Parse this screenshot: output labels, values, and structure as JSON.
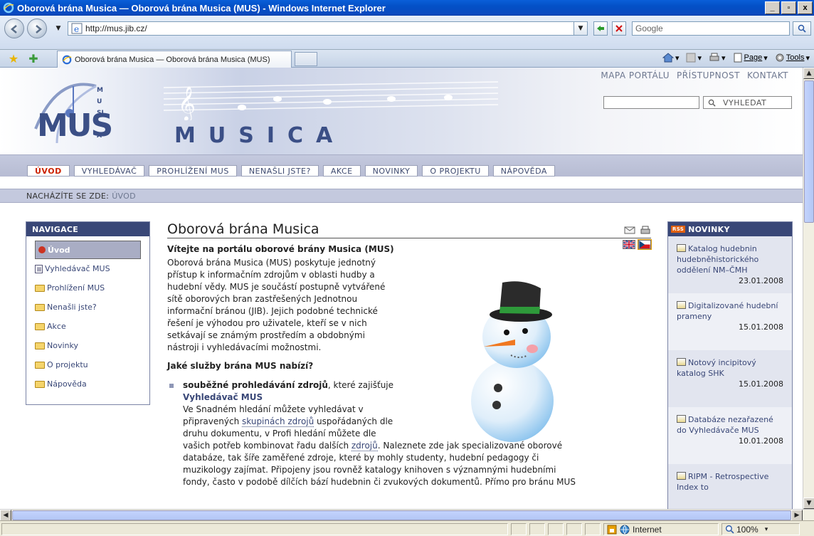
{
  "window": {
    "title": "Oborová brána Musica — Oborová brána Musica (MUS) - Windows Internet Explorer",
    "min": "_",
    "max": "▫",
    "close": "x"
  },
  "address": {
    "url": "http://mus.jib.cz/",
    "search_placeholder": "Google"
  },
  "tab": {
    "label": "Oborová brána Musica — Oborová brána Musica (MUS)"
  },
  "commands": {
    "page": "Page",
    "tools": "Tools"
  },
  "site": {
    "top_links": [
      "MAPA PORTÁLU",
      "PŘÍSTUPNOST",
      "KONTAKT"
    ],
    "search_button": "VYHLEDAT",
    "logo_text": "MUS",
    "logo_side": "MUSICA",
    "brand_word": "MUSICA",
    "nav": [
      "ÚVOD",
      "VYHLEDÁVAČ",
      "PROHLÍŽENÍ MUS",
      "NENAŠLI JSTE?",
      "AKCE",
      "NOVINKY",
      "O PROJEKTU",
      "NÁPOVĚDA"
    ],
    "breadcrumb_label": "NACHÁZÍTE SE ZDE:",
    "breadcrumb_here": "ÚVOD"
  },
  "leftnav": {
    "title": "NAVIGACE",
    "items": [
      "Úvod",
      "Vyhledávač MUS",
      "Prohlížení MUS",
      "Nenašli jste?",
      "Akce",
      "Novinky",
      "O projektu",
      "Nápověda"
    ]
  },
  "content": {
    "title": "Oborová brána Musica",
    "subtitle": "Vítejte na portálu oborové brány Musica (MUS)",
    "intro_lines": [
      "Oborová brána Musica (MUS) poskytuje jednotný",
      "přístup k informačním zdrojům v oblasti hudby a",
      "hudební vědy. MUS je součástí postupně vytvářené",
      "sítě oborových bran zastřešených Jednotnou",
      "informační bránou (JIB). Jejich podobné technické",
      "řešení je výhodou pro uživatele, kteří se v nich",
      "setkávají se známým prostředím a obdobnými",
      "nástroji i vyhledávacími možnostmi."
    ],
    "services_heading": "Jaké služby brána MUS nabízí?",
    "bullet_bold": "souběžné prohledávání zdrojů",
    "bullet_rest": ", které zajišťuje",
    "bullet_link": "Vyhledávač MUS",
    "b_line1": "Ve Snadném hledání můžete vyhledávat v",
    "b_line2_a": "připravených ",
    "b_line2_link": "skupinách zdrojů",
    "b_line2_b": " uspořádaných dle",
    "b_line3": "druhu dokumentu, v Profi hledání můžete dle",
    "b_line4_a": "vašich potřeb kombinovat řadu dalších ",
    "b_line4_link": "zdrojů",
    "b_line4_b": ". Naleznete zde jak specializované oborové",
    "b_line5": "databáze, tak šíře zaměřené zdroje, které by mohly studenty, hudební pedagogy či",
    "b_line6": "muzikology zajímat. Připojeny jsou rovněž katalogy knihoven s významnými hudebními",
    "b_line7": "fondy, často v podobě dílčích bází hudebnin či zvukových dokumentů. Přímo pro bránu MUS"
  },
  "news": {
    "title": "NOVINKY",
    "rss": "RSS",
    "items": [
      {
        "text": "Katalog hudebnin hudebněhistorického oddělení NM–ČMH",
        "date": "23.01.2008"
      },
      {
        "text": "Digitalizované hudební prameny",
        "date": "15.01.2008"
      },
      {
        "text": "Notový incipitový katalog SHK",
        "date": "15.01.2008"
      },
      {
        "text": "Databáze nezařazené do Vyhledávače MUS",
        "date": "10.01.2008"
      },
      {
        "text": "RIPM - Retrospective Index to",
        "date": ""
      }
    ]
  },
  "status": {
    "zone": "Internet",
    "zoom": "100%"
  }
}
